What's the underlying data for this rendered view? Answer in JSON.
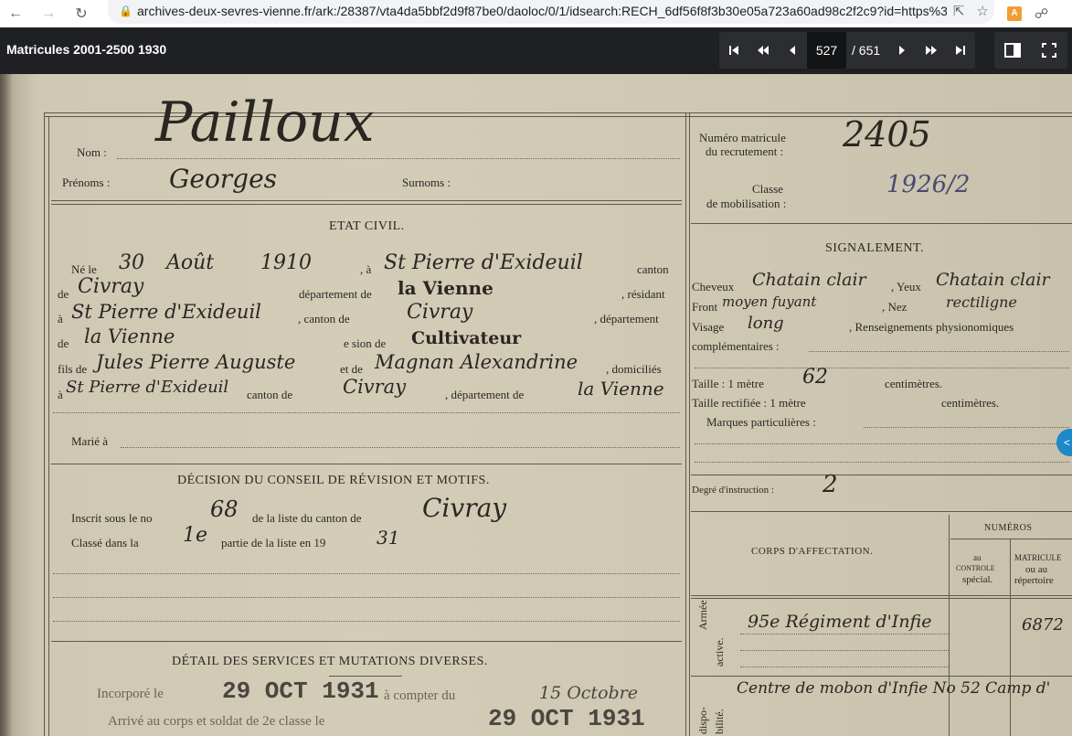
{
  "browser": {
    "url": "archives-deux-sevres-vienne.fr/ark:/28387/vta4da5bbf2d9f87be0/daoloc/0/1/idsearch:RECH_6df56f8f3b30e05a723a60ad98c2f2c9?id=https%3A...",
    "extension_badge": "A"
  },
  "viewer": {
    "title": "Matricules 2001-2500 1930",
    "page_current": "527",
    "page_total": "/ 651"
  },
  "record": {
    "labels": {
      "nom": "Nom :",
      "prenoms": "Prénoms :",
      "surnoms": "Surnoms :",
      "numero_matricule": "Numéro matricule",
      "du_recrutement": "du recrutement :",
      "classe": "Classe",
      "de_mobilisation": "de mobilisation :",
      "etat_civil": "ETAT CIVIL.",
      "ne_le": "Né le",
      "a": ", à",
      "canton": "canton",
      "de": "de",
      "departement_de": "département de",
      "residant": ", résidant",
      "a2": "à",
      "canton_de": ", canton de",
      "departement": ", département",
      "de2": "de",
      "e_sion_de": "e sion de",
      "fils_de": "fils de",
      "et_de": "et de",
      "domicilies": ", domiciliés",
      "a3": "à",
      "canton_de2": "canton de",
      "departement_de2": ", département de",
      "marie_a": "Marié à",
      "signalement": "SIGNALEMENT.",
      "cheveux": "Cheveux",
      "yeux": ", Yeux",
      "front": "Front",
      "nez": ", Nez",
      "visage": "Visage",
      "renseignements": ", Renseignements physionomiques",
      "complementaires": "complémentaires :",
      "taille": "Taille : 1 mètre",
      "centimetres": "centimètres.",
      "taille_rectifiee": "Taille rectifiée : 1 mètre",
      "centimetres2": "centimètres.",
      "marques": "Marques particulières :",
      "decision": "DÉCISION DU CONSEIL DE RÉVISION ET MOTIFS.",
      "inscrit": "Inscrit sous le no",
      "de_la_liste": "de la liste du canton de",
      "classe_dans": "Classé dans la",
      "partie": "partie de la liste en 19",
      "degre": "Degré d'instruction :",
      "numeros": "NUMÉROS",
      "corps": "CORPS D'AFFECTATION.",
      "au_controle": "au",
      "controle2": "CONTROLE",
      "special": "spécial.",
      "matricule_col": "MATRICULE",
      "ou_au": "ou au",
      "repertoire": "répertoire",
      "detail": "DÉTAIL DES SERVICES ET MUTATIONS DIVERSES.",
      "armee": "Armée",
      "active": "active.",
      "dispo": "dispo-",
      "bilite": "bilité."
    },
    "handwritten": {
      "nom": "Pailloux",
      "prenoms": "Georges",
      "numero": "2405",
      "classe": "1926/2",
      "jour": "30",
      "mois": "Août",
      "annee": "1910",
      "lieu": "St Pierre d'Exideuil",
      "canton": "Civray",
      "departement": "la Vienne",
      "residence": "St Pierre d'Exideuil",
      "canton_res": "Civray",
      "dep_res": "la Vienne",
      "profession": "Cultivateur",
      "pere": "Jules Pierre Auguste",
      "mere": "Magnan Alexandrine",
      "domicile": "St Pierre d'Exideuil",
      "canton_dom": "Civray",
      "dep_dom": "la Vienne",
      "cheveux": "Chatain clair",
      "yeux": "Chatain clair",
      "front": "moyen fuyant",
      "nez": "rectiligne",
      "visage": "long",
      "taille_cm": "62",
      "numero_liste": "68",
      "canton_liste": "Civray",
      "partie": "1e",
      "annee_liste": "31",
      "degre": "2",
      "corps1": "95e Régiment d'Infie",
      "matricule1": "6872",
      "corps2": "Centre de mobon d'Infie No 52 Camp d'",
      "incorpore": "Incorporé le",
      "incorpore_date": "29 OCT 1931",
      "a_compter": "à compter du",
      "compter_date": "15 Octobre",
      "arrive": "Arrivé au corps et soldat de 2e classe le",
      "arrive_date": "29 OCT 1931"
    }
  }
}
